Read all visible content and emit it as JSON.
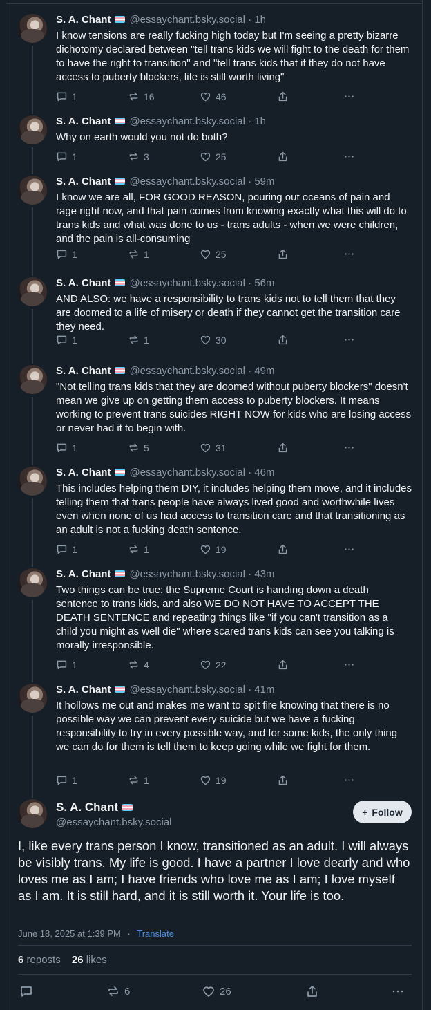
{
  "author": {
    "name": "S. A. Chant",
    "handle": "@essaychant.bsky.social"
  },
  "icons": {
    "reply": "reply-icon",
    "repost": "repost-icon",
    "like": "heart-icon",
    "share": "share-icon",
    "more": "more-icon",
    "flag": "trans-flag-emoji"
  },
  "colors": {
    "background": "#161e27",
    "muted": "#8c9aa8",
    "link": "#4a90e2",
    "follow_bg": "#e3e8ee"
  },
  "thread": [
    {
      "time": "· 1h",
      "text": "I know tensions are really fucking high today but I'm seeing a pretty bizarre dichotomy declared between \"tell trans kids we will fight to the death for them to have the right to transition\" and \"tell trans kids that if they do not have access to puberty blockers, life is still worth living\"",
      "replies": "1",
      "reposts": "16",
      "likes": "46"
    },
    {
      "time": "· 1h",
      "text": "Why on earth would you not do both?",
      "replies": "1",
      "reposts": "3",
      "likes": "25"
    },
    {
      "time": "· 59m",
      "text": "I know we are all, FOR GOOD REASON, pouring out oceans of pain and rage right now, and that pain comes from knowing exactly what this will do to trans kids and what was done to us - trans adults - when we were children, and the pain is all-consuming",
      "replies": "1",
      "reposts": "1",
      "likes": "25"
    },
    {
      "time": "· 56m",
      "text": "AND ALSO: we have a responsibility to trans kids not to tell them that they are doomed to a life of misery or death if they cannot get the transition care they need.",
      "replies": "1",
      "reposts": "1",
      "likes": "30"
    },
    {
      "time": "· 49m",
      "text": "\"Not telling trans kids that they are doomed without puberty blockers\" doesn't mean we give up on getting them access to puberty blockers. It means working to prevent trans suicides RIGHT NOW for kids who are losing access or never had it to begin with.",
      "replies": "1",
      "reposts": "5",
      "likes": "31"
    },
    {
      "time": "· 46m",
      "text": "This includes helping them DIY, it includes helping them move, and it includes telling them that trans people have always lived good and worthwhile lives even when none of us had access to transition care and that transitioning as an adult is not a fucking death sentence.",
      "replies": "1",
      "reposts": "1",
      "likes": "19"
    },
    {
      "time": "· 43m",
      "text": "Two things can be true: the Supreme Court is handing down a death sentence to trans kids, and also WE DO NOT HAVE TO ACCEPT THE DEATH SENTENCE and repeating things like \"if you can't transition as a child you might as well die\" where scared trans kids can see you talking is morally irresponsible.",
      "replies": "1",
      "reposts": "4",
      "likes": "22"
    },
    {
      "time": "· 41m",
      "text": "It hollows me out and makes me want to spit fire knowing that there is no possible way we can prevent every suicide but we have a fucking responsibility to try in every possible way, and for some kids, the only thing we can do for them is tell them to keep going while we fight for them.",
      "replies": "1",
      "reposts": "1",
      "likes": "19"
    }
  ],
  "main_post": {
    "name": "S. A. Chant",
    "handle": "@essaychant.bsky.social",
    "follow_label": "Follow",
    "text": "I, like every trans person I know, transitioned as an adult. I will always be visibly trans. My life is good. I have a partner I love dearly and who loves me as I am; I have friends who love me as I am; I love myself as I am. It is still hard, and it is still worth it. Your life is too.",
    "timestamp": "June 18, 2025 at 1:39 PM",
    "separator": "·",
    "translate": "Translate",
    "reposts_count": "6",
    "reposts_label": "reposts",
    "likes_count": "26",
    "likes_label": "likes",
    "action_reposts": "6",
    "action_likes": "26"
  }
}
